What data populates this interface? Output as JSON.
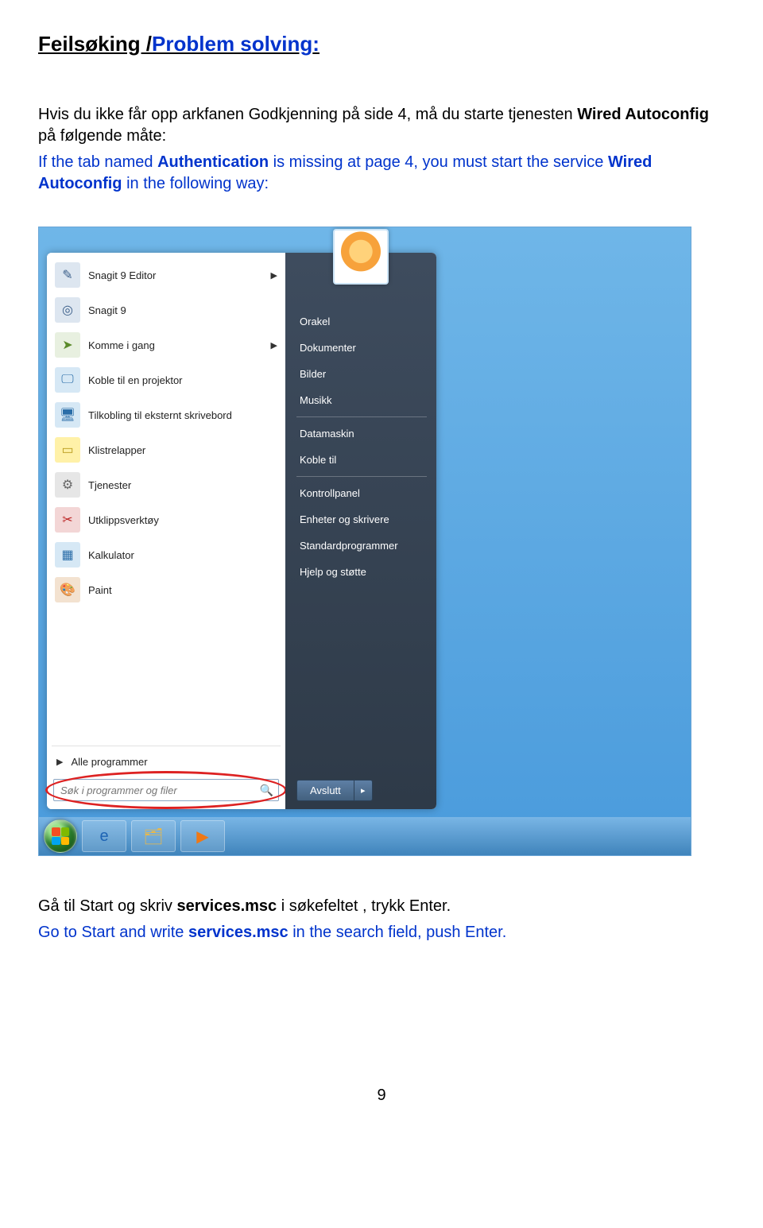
{
  "heading": {
    "part1": "Feilsøking /",
    "part2": "Problem solving",
    "part3": ":"
  },
  "para_nb": {
    "t1": "Hvis du ikke får opp arkfanen Godkjenning  på side 4, må du starte tjenesten ",
    "b1": "Wired Autoconfig",
    "t2": " på følgende måte:"
  },
  "para_en": {
    "t1": "If the tab named ",
    "b1": "Authentication",
    "t2": "  is missing at page 4, you must start the service ",
    "b2": "Wired Autoconfig",
    "t3": " in the following way:"
  },
  "startmenu": {
    "left": [
      {
        "label": "Snagit 9 Editor",
        "arrow": true,
        "iconClass": "ic-snagit-ed",
        "glyph": "✎"
      },
      {
        "label": "Snagit 9",
        "arrow": false,
        "iconClass": "ic-snagit",
        "glyph": "◎"
      },
      {
        "label": "Komme i gang",
        "arrow": true,
        "iconClass": "ic-start",
        "glyph": "➤"
      },
      {
        "label": "Koble til en projektor",
        "arrow": false,
        "iconClass": "ic-proj",
        "glyph": "🖵"
      },
      {
        "label": "Tilkobling til eksternt skrivebord",
        "arrow": false,
        "iconClass": "ic-rdp",
        "glyph": "🖥"
      },
      {
        "label": "Klistrelapper",
        "arrow": false,
        "iconClass": "ic-notes",
        "glyph": "▭"
      },
      {
        "label": "Tjenester",
        "arrow": false,
        "iconClass": "ic-services",
        "glyph": "⚙"
      },
      {
        "label": "Utklippsverktøy",
        "arrow": false,
        "iconClass": "ic-snip",
        "glyph": "✂"
      },
      {
        "label": "Kalkulator",
        "arrow": false,
        "iconClass": "ic-calc",
        "glyph": "▦"
      },
      {
        "label": "Paint",
        "arrow": false,
        "iconClass": "ic-paint",
        "glyph": "🎨"
      }
    ],
    "all_programs": "Alle programmer",
    "search_placeholder": "Søk i programmer og filer",
    "right": [
      "Orakel",
      "Dokumenter",
      "Bilder",
      "Musikk",
      "__sep__",
      "Datamaskin",
      "Koble til",
      "__sep__",
      "Kontrollpanel",
      "Enheter og skrivere",
      "Standardprogrammer",
      "Hjelp og støtte"
    ],
    "shutdown": "Avslutt"
  },
  "footer": {
    "nb_1": "Gå til Start og skriv ",
    "nb_b": "services.msc",
    "nb_2": " i søkefeltet , trykk Enter.",
    "en_1": "Go to Start and write ",
    "en_b": "services.msc",
    "en_2": " in the search field, push Enter."
  },
  "page_number": "9"
}
